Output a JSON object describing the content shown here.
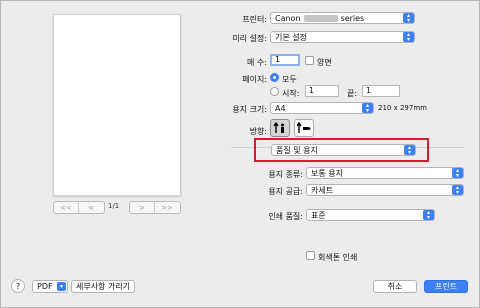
{
  "printer": {
    "label": "프린터:",
    "brand": "Canon",
    "model": "series"
  },
  "presets": {
    "label": "미리 설정:",
    "value": "기본 설정"
  },
  "copies": {
    "label": "매 수:",
    "value": "1",
    "two_sided_label": "양면"
  },
  "pages": {
    "label": "페이지:",
    "all_label": "모두",
    "from_label": "시작:",
    "from_value": "1",
    "to_label": "끝:",
    "to_value": "1"
  },
  "paper_size": {
    "label": "용지 크기:",
    "value": "A4",
    "dimensions": "210 x 297mm"
  },
  "orientation": {
    "label": "방향:"
  },
  "section": {
    "value": "품질 및 용지"
  },
  "media_type": {
    "label": "용지 종류:",
    "value": "보통 용지"
  },
  "paper_source": {
    "label": "용지 공급:",
    "value": "카세트"
  },
  "print_quality": {
    "label": "인쇄 품질:",
    "value": "표준"
  },
  "grayscale": {
    "label": "회색톤 인쇄"
  },
  "preview_nav": {
    "first": "<<",
    "prev": "<",
    "page_indicator": "1/1",
    "next": ">",
    "last": ">>"
  },
  "footer": {
    "help": "?",
    "pdf": "PDF",
    "hide_details": "세부사항 가리기",
    "cancel": "취소",
    "print": "프린트"
  },
  "colors": {
    "accent": "#3d7ff5",
    "highlight_box": "#d2202a"
  }
}
